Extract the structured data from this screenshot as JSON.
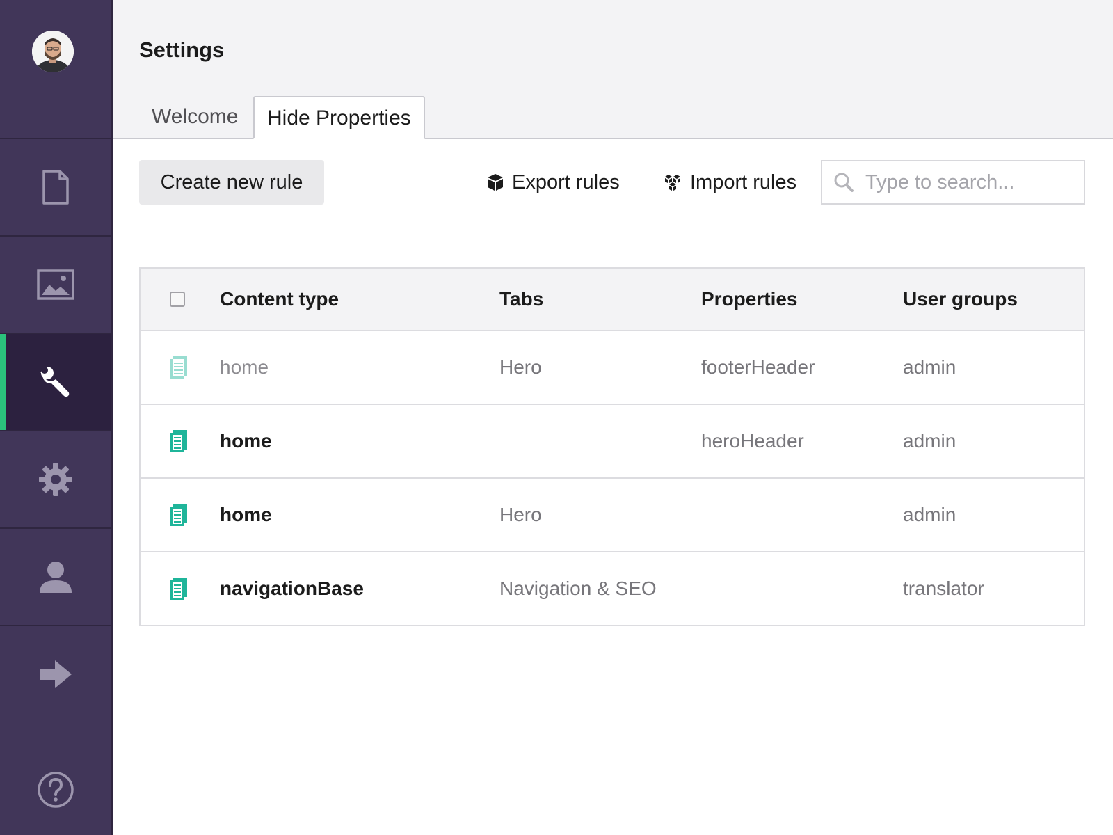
{
  "header": {
    "title": "Settings",
    "tabs": [
      {
        "label": "Welcome",
        "active": false
      },
      {
        "label": "Hide Properties",
        "active": true
      }
    ]
  },
  "sidebar": {
    "items": [
      {
        "icon": "document-icon",
        "active": false
      },
      {
        "icon": "image-icon",
        "active": false
      },
      {
        "icon": "wrench-icon",
        "active": true
      },
      {
        "icon": "gear-icon",
        "active": false
      },
      {
        "icon": "user-icon",
        "active": false
      },
      {
        "icon": "arrow-right-icon",
        "active": false
      }
    ],
    "help_icon": "help-icon",
    "accent_color": "#2bc37c",
    "background_color": "#413659"
  },
  "toolbar": {
    "create_label": "Create new rule",
    "export_label": "Export rules",
    "import_label": "Import rules",
    "search_placeholder": "Type to search..."
  },
  "table": {
    "headers": {
      "content_type": "Content type",
      "tabs": "Tabs",
      "properties": "Properties",
      "user_groups": "User groups"
    },
    "rows": [
      {
        "content_type": "home",
        "tabs": "Hero",
        "properties": "footerHeader",
        "user_groups": "admin",
        "disabled": true
      },
      {
        "content_type": "home",
        "tabs": "",
        "properties": "heroHeader",
        "user_groups": "admin",
        "disabled": false
      },
      {
        "content_type": "home",
        "tabs": "Hero",
        "properties": "",
        "user_groups": "admin",
        "disabled": false
      },
      {
        "content_type": "navigationBase",
        "tabs": "Navigation & SEO",
        "properties": "",
        "user_groups": "translator",
        "disabled": false
      }
    ],
    "row_icon_color": "#1fb59a"
  }
}
